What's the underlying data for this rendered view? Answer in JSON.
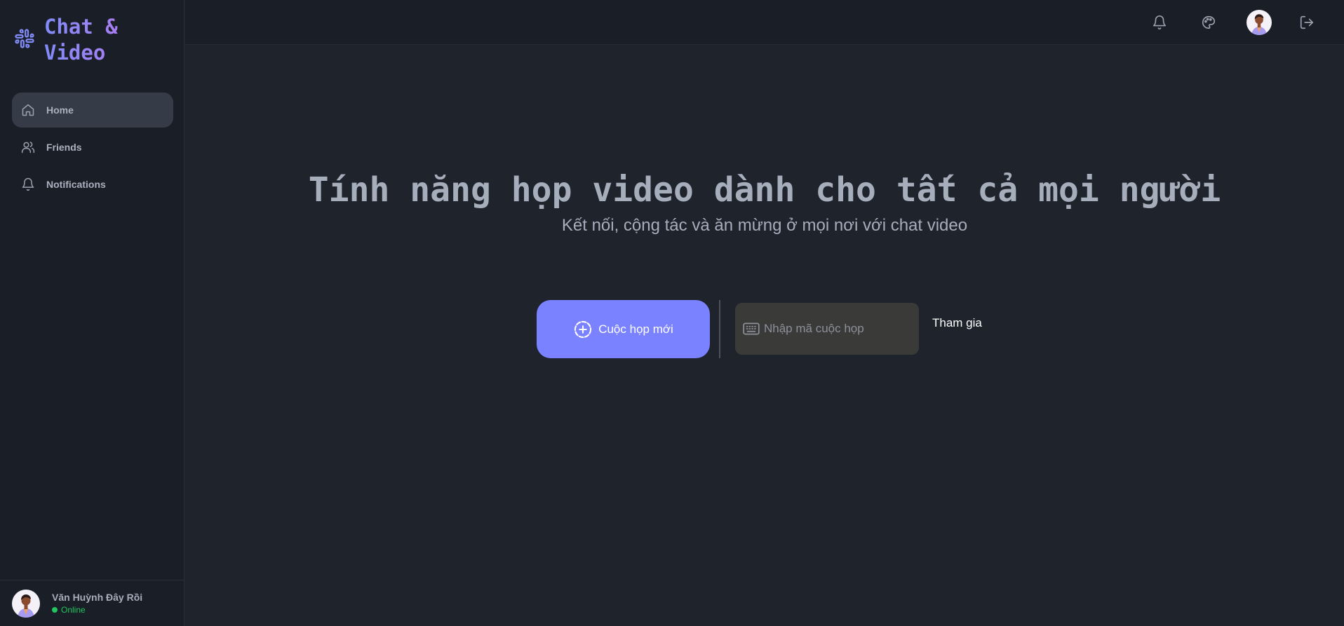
{
  "brand": {
    "title": "Chat & Video",
    "icon": "slack-hash-icon",
    "accent": "#818cf8"
  },
  "sidebar": {
    "items": [
      {
        "label": "Home",
        "icon": "home-icon",
        "active": true
      },
      {
        "label": "Friends",
        "icon": "users-icon",
        "active": false
      },
      {
        "label": "Notifications",
        "icon": "bell-icon",
        "active": false
      }
    ]
  },
  "profile": {
    "name": "Văn Huỳnh Đây Rồi",
    "status": "Online",
    "status_color": "#22c55e"
  },
  "topbar": {
    "icons": [
      "bell-icon",
      "palette-icon",
      "avatar",
      "logout-icon"
    ]
  },
  "hero": {
    "title": "Tính năng họp video dành cho tất cả mọi người",
    "subtitle": "Kết nối, cộng tác và ăn mừng ở mọi nơi với chat video"
  },
  "actions": {
    "new_meeting_label": "Cuộc họp mới",
    "code_placeholder": "Nhập mã cuộc họp",
    "join_label": "Tham gia",
    "button_color": "#7b82ff"
  }
}
